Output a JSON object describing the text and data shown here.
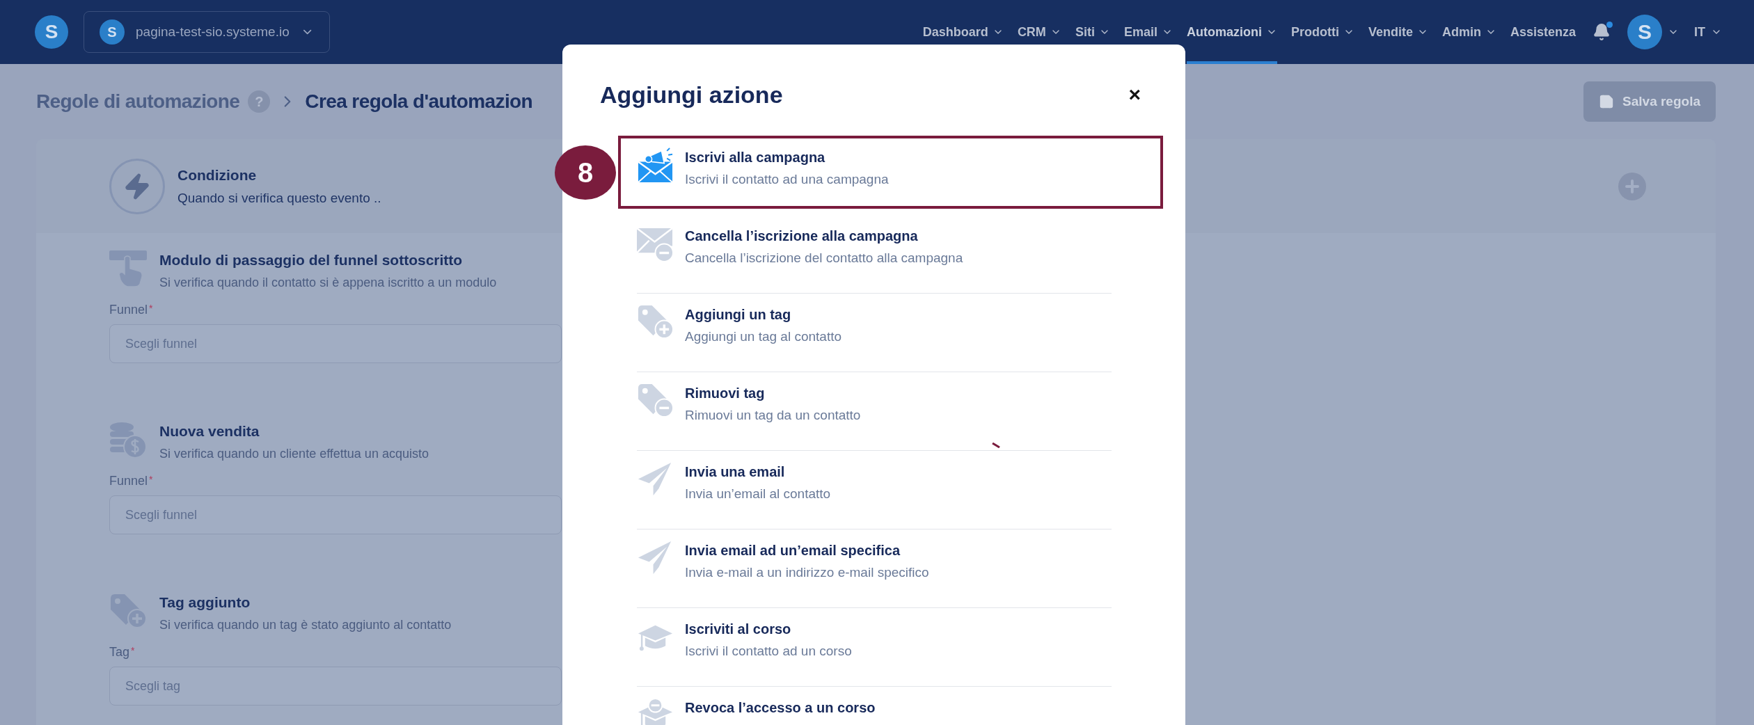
{
  "header": {
    "logo": "S",
    "workspace": {
      "icon": "S",
      "name": "pagina-test-sio.systeme.io"
    },
    "nav": [
      {
        "label": "Dashboard",
        "selected": false,
        "dropdown": true
      },
      {
        "label": "CRM",
        "selected": false,
        "dropdown": true
      },
      {
        "label": "Siti",
        "selected": false,
        "dropdown": true
      },
      {
        "label": "Email",
        "selected": false,
        "dropdown": true
      },
      {
        "label": "Automazioni",
        "selected": true,
        "dropdown": true
      },
      {
        "label": "Prodotti",
        "selected": false,
        "dropdown": true
      },
      {
        "label": "Vendite",
        "selected": false,
        "dropdown": true
      },
      {
        "label": "Admin",
        "selected": false,
        "dropdown": true
      },
      {
        "label": "Assistenza",
        "selected": false,
        "dropdown": false
      }
    ],
    "notification": true,
    "avatar": "S",
    "language": "IT"
  },
  "breadcrumb": {
    "parent": "Regole di automazione",
    "help": "?",
    "current": "Crea regola d'automazion"
  },
  "save_button": {
    "label": "Salva regola",
    "disabled": true
  },
  "condition": {
    "title": "Condizione",
    "subtitle": "Quando si verifica questo evento .."
  },
  "triggers": [
    {
      "kind": "form",
      "title": "Modulo di passaggio del funnel sottoscritto",
      "description": "Si verifica quando il contatto si è appena iscritto a un modulo",
      "field_label": "Funnel",
      "required_mark": "*",
      "placeholder": "Scegli funnel"
    },
    {
      "kind": "sale",
      "title": "Nuova vendita",
      "description": "Si verifica quando un cliente effettua un acquisto",
      "field_label": "Funnel",
      "required_mark": "*",
      "placeholder": "Scegli funnel"
    },
    {
      "kind": "tag_added",
      "title": "Tag aggiunto",
      "description": "Si verifica quando un tag è stato aggiunto al contatto",
      "field_label": "Tag",
      "required_mark": "*",
      "placeholder": "Scegli tag"
    }
  ],
  "modal": {
    "title": "Aggiungi azione",
    "close": "×",
    "actions": [
      {
        "kind": "campaign_subscribe",
        "title": "Iscrivi alla campagna",
        "description": "Iscrivi il contatto ad una campagna",
        "highlighted": true
      },
      {
        "kind": "campaign_unsubscribe",
        "title": "Cancella l’iscrizione alla campagna",
        "description": "Cancella l’iscrizione del contatto alla campagna",
        "highlighted": false
      },
      {
        "kind": "tag_add",
        "title": "Aggiungi un tag",
        "description": "Aggiungi un tag al contatto",
        "highlighted": false
      },
      {
        "kind": "tag_remove",
        "title": "Rimuovi tag",
        "description": "Rimuovi un tag da un contatto",
        "highlighted": false
      },
      {
        "kind": "email",
        "title": "Invia una email",
        "description": "Invia un’email al contatto",
        "highlighted": false
      },
      {
        "kind": "email",
        "title": "Invia email ad un’email specifica",
        "description": "Invia e-mail a un indirizzo e-mail specifico",
        "highlighted": false
      },
      {
        "kind": "course_enroll",
        "title": "Iscriviti al corso",
        "description": "Iscrivi il contatto ad un corso",
        "highlighted": false
      },
      {
        "kind": "course_revoke",
        "title": "Revoca l’accesso a un corso",
        "highlighted": false
      }
    ]
  },
  "annotation": {
    "number": "8"
  }
}
